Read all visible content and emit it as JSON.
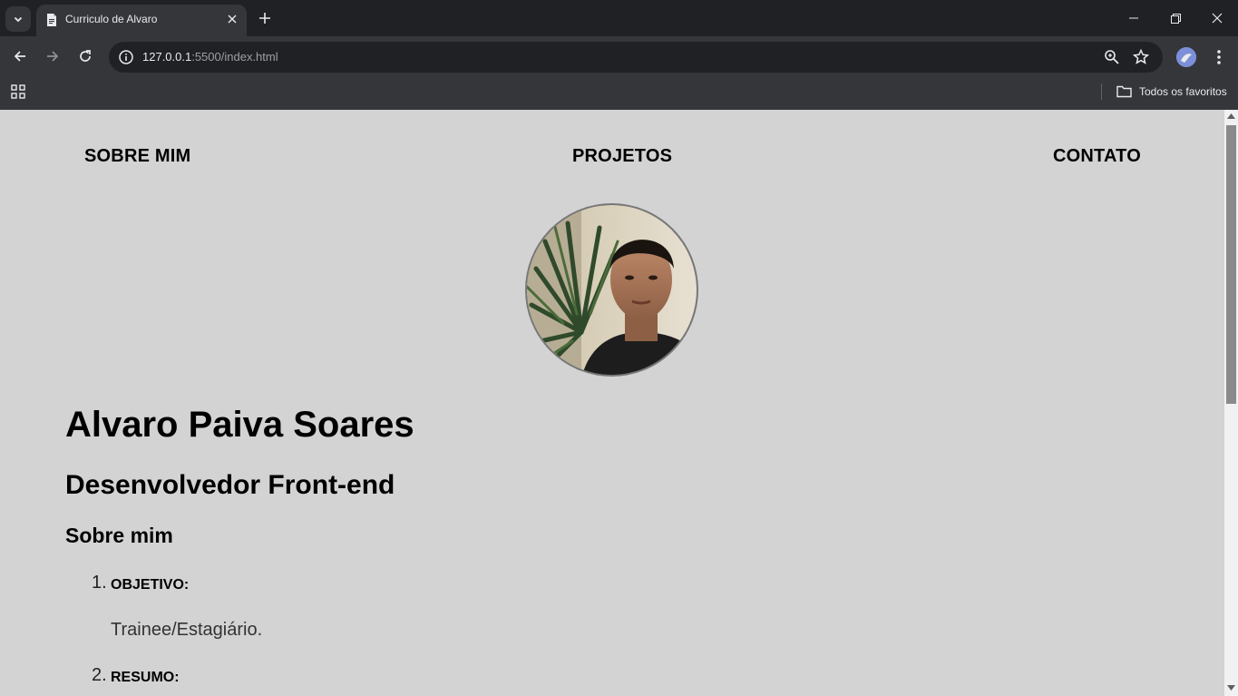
{
  "browser": {
    "tab_title": "Curriculo de Alvaro",
    "url_host": "127.0.0.1",
    "url_rest": ":5500/index.html",
    "bookmarks_all_label": "Todos os favoritos"
  },
  "page": {
    "nav": [
      "SOBRE MIM",
      "PROJETOS",
      "CONTATO"
    ],
    "name": "Alvaro Paiva Soares",
    "role": "Desenvolvedor Front-end",
    "section_title": "Sobre mim",
    "items": [
      {
        "number": "1.",
        "title": "OBJETIVO:",
        "text": "Trainee/Estagiário."
      },
      {
        "number": "2.",
        "title": "RESUMO:"
      }
    ]
  }
}
